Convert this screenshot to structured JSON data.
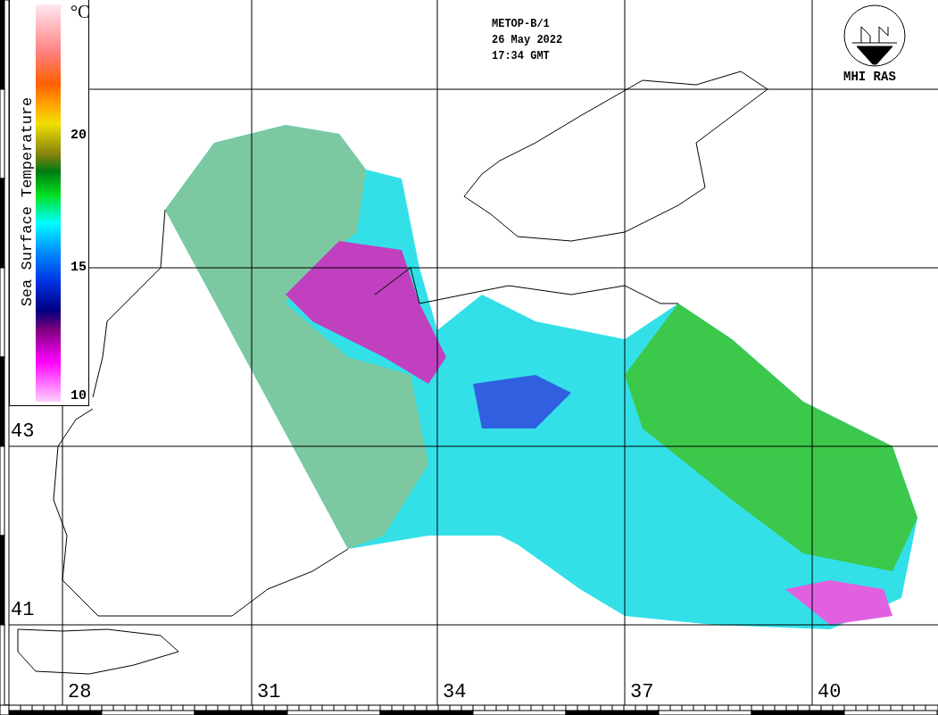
{
  "header": {
    "satellite": "METOP-B/1",
    "date": "26 May 2022",
    "time": "17:34 GMT"
  },
  "logo": {
    "caption": "MHI RAS"
  },
  "legend": {
    "title": "Sea Surface Temperature",
    "unit": "°C",
    "ticks": [
      "20",
      "15",
      "10"
    ]
  },
  "longitude_labels": [
    "28",
    "31",
    "34",
    "37",
    "40"
  ],
  "latitude_labels": [
    "43",
    "41"
  ]
}
